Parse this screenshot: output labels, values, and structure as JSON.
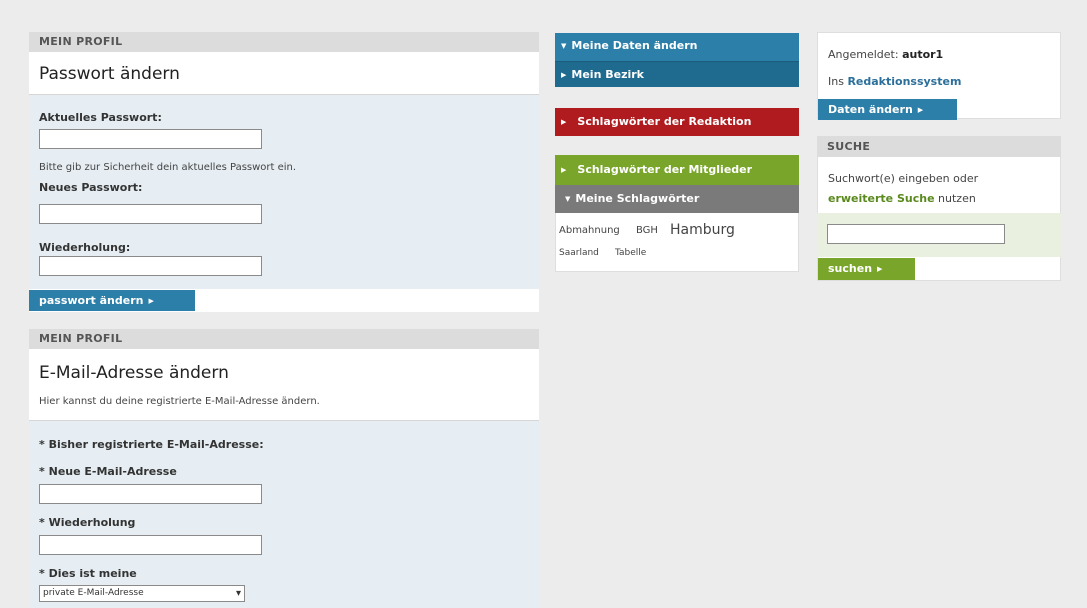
{
  "password_section": {
    "header": "MEIN PROFIL",
    "title": "Passwort ändern",
    "current_label": "Aktuelles Passwort:",
    "current_hint": "Bitte gib zur Sicherheit dein aktuelles Passwort ein.",
    "new_label": "Neues Passwort:",
    "repeat_label": "Wiederholung:",
    "submit_label": "passwort ändern"
  },
  "email_section": {
    "header": "MEIN PROFIL",
    "title": "E-Mail-Adresse ändern",
    "description": "Hier kannst du deine registrierte E-Mail-Adresse ändern.",
    "registered_label": "Bisher registrierte E-Mail-Adresse:",
    "new_label": "Neue E-Mail-Adresse",
    "repeat_label": "Wiederholung",
    "type_label": "Dies ist meine",
    "type_value": "private E-Mail-Adresse",
    "required_mark": "*"
  },
  "nav": {
    "meine_daten": "Meine Daten ändern",
    "mein_bezirk": "Mein Bezirk",
    "redaktion": "Schlagwörter der Redaktion",
    "mitglieder": "Schlagwörter der Mitglieder",
    "meine_schlagwoerter": "Meine Schlagwörter",
    "tags": [
      "Abmahnung",
      "BGH",
      "Hamburg",
      "Saarland",
      "Tabelle"
    ]
  },
  "account": {
    "logged_in_label": "Angemeldet:",
    "username": "autor1",
    "cms_prefix": "Ins",
    "cms_link": "Redaktionssystem",
    "change_data_button": "Daten ändern"
  },
  "search": {
    "header": "SUCHE",
    "text_before": "Suchwort(e) eingeben oder",
    "advanced_link": "erweiterte Suche",
    "text_after": "nutzen",
    "query_value": "",
    "submit_label": "suchen"
  },
  "colors": {
    "blue": "#2c7fa8",
    "red": "#b01b1f",
    "green": "#79a62a",
    "gray": "#7a7a7a"
  },
  "icons": {
    "triangle_right": "▶",
    "triangle_down": "▼",
    "select_arrow": "▾"
  }
}
